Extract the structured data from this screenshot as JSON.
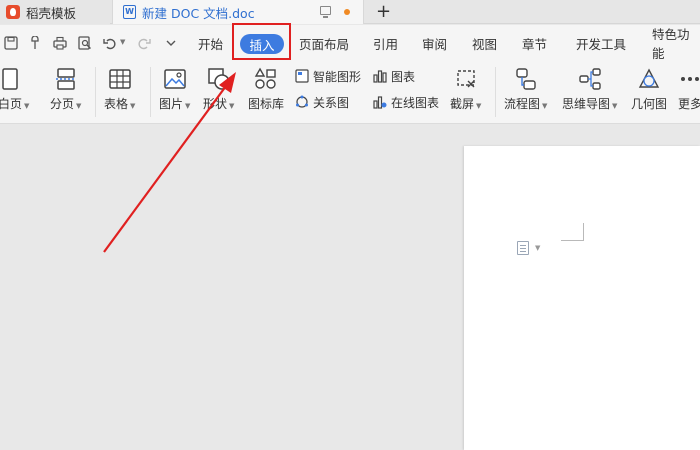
{
  "tabs": {
    "home_label": "稻壳模板",
    "doc_label": "新建 DOC 文档.doc"
  },
  "menu": {
    "items": [
      "开始",
      "插入",
      "页面布局",
      "引用",
      "审阅",
      "视图",
      "章节",
      "开发工具",
      "特色功能"
    ],
    "active": "插入"
  },
  "ribbon": {
    "blank_page": "空白页",
    "page_break": "分页",
    "table": "表格",
    "picture": "图片",
    "shape": "形状",
    "icon_lib": "图标库",
    "smart_art": "智能图形",
    "relation": "关系图",
    "chart": "图表",
    "online_chart": "在线图表",
    "screenshot": "截屏",
    "flowchart": "流程图",
    "mindmap": "思维导图",
    "geometry": "几何图",
    "more": "更多"
  },
  "colors": {
    "active_tab": "#3d7be0",
    "highlight": "#e02020",
    "arrow": "#e02020"
  }
}
